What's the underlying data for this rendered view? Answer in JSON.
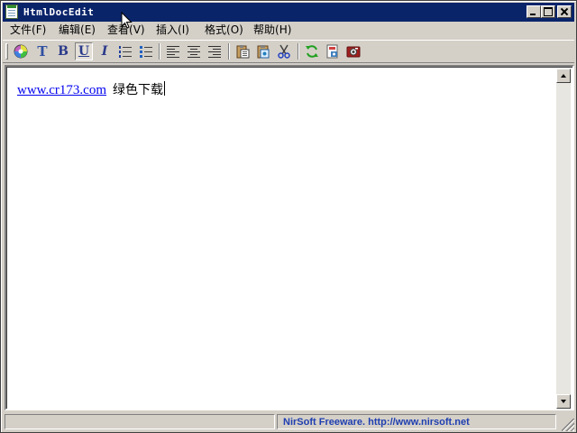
{
  "window": {
    "title": "HtmlDocEdit",
    "icon": "notepad-icon"
  },
  "menubar": {
    "items": [
      {
        "label": "文件",
        "accel": "(F)",
        "accel_letter": "F"
      },
      {
        "label": "编辑",
        "accel": "(E)",
        "accel_letter": "E"
      },
      {
        "label": "查看",
        "accel": "(V)",
        "accel_letter": "V"
      },
      {
        "label": "插入",
        "accel": "(I)",
        "accel_letter": "I"
      },
      {
        "label": "格式",
        "accel": "(O)",
        "accel_letter": "O"
      },
      {
        "label": "帮助",
        "accel": "(H)",
        "accel_letter": "H"
      }
    ]
  },
  "toolbar": {
    "bold": "B",
    "underline": "U",
    "italic": "I",
    "font_glyph": "T",
    "underline_pressed": true
  },
  "editor": {
    "link_text": "www.cr173.com",
    "text": "绿色下载"
  },
  "statusbar": {
    "left": "",
    "right": "NirSoft Freeware.  http://www.nirsoft.net"
  },
  "colors": {
    "titlebar": "#0a246a",
    "face": "#d4d0c8",
    "link": "#0000ee",
    "status_text": "#1f3fb0"
  }
}
